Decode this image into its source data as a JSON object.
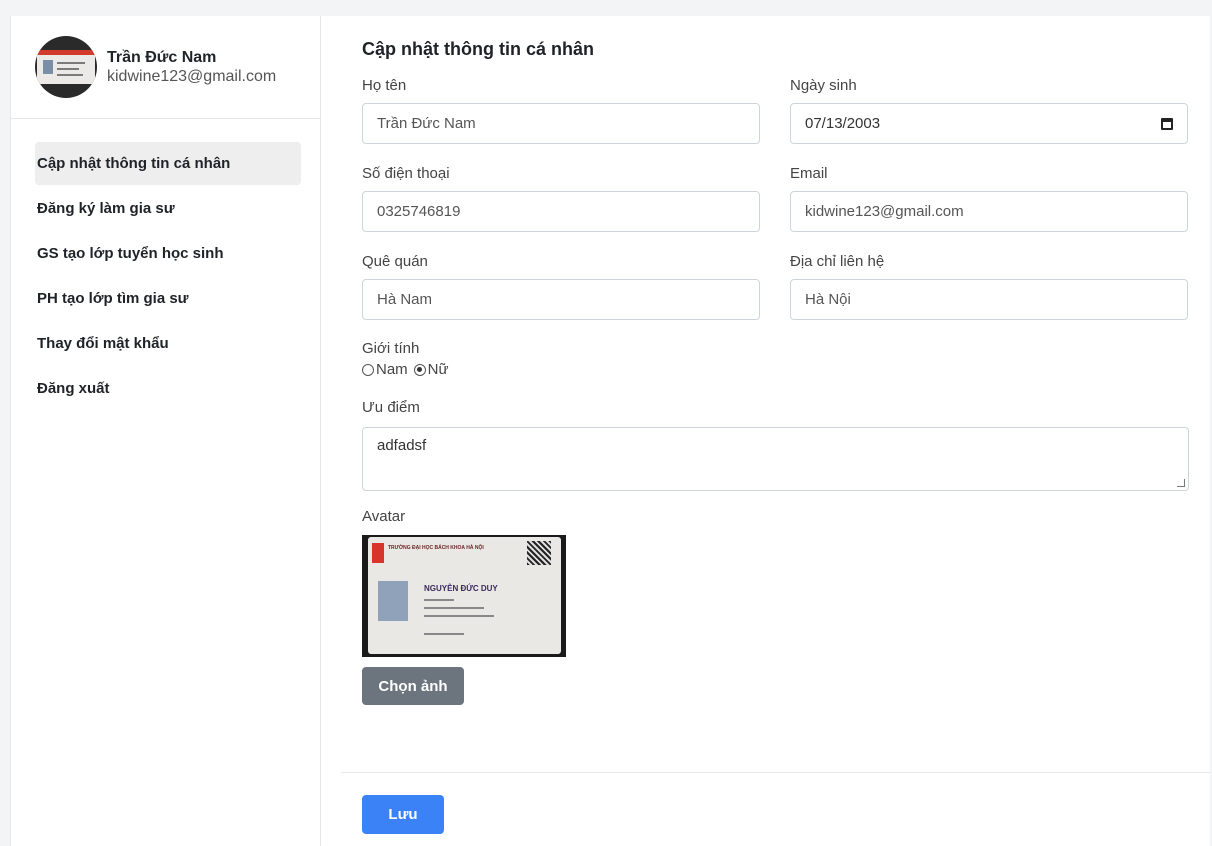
{
  "user": {
    "name": "Trần Đức Nam",
    "email": "kidwine123@gmail.com"
  },
  "menu": [
    {
      "label": "Cập nhật thông tin cá nhân",
      "active": true
    },
    {
      "label": "Đăng ký làm gia sư",
      "active": false
    },
    {
      "label": "GS tạo lớp tuyển học sinh",
      "active": false
    },
    {
      "label": "PH tạo lớp tìm gia sư",
      "active": false
    },
    {
      "label": "Thay đổi mật khẩu",
      "active": false
    },
    {
      "label": "Đăng xuất",
      "active": false
    }
  ],
  "form": {
    "title": "Cập nhật thông tin cá nhân",
    "full_name": {
      "label": "Họ tên",
      "value": "Trần Đức Nam"
    },
    "birthday": {
      "label": "Ngày sinh",
      "value": "07/13/2003"
    },
    "phone": {
      "label": "Số điện thoại",
      "value": "0325746819"
    },
    "email": {
      "label": "Email",
      "value": "kidwine123@gmail.com"
    },
    "hometown": {
      "label": "Quê quán",
      "value": "Hà Nam"
    },
    "address": {
      "label": "Địa chỉ liên hệ",
      "value": "Hà Nội"
    },
    "gender": {
      "label": "Giới tính",
      "options": [
        "Nam",
        "Nữ"
      ],
      "selected": "Nữ"
    },
    "strengths": {
      "label": "Ưu điểm",
      "value": "adfadsf"
    },
    "avatar": {
      "label": "Avatar",
      "card_school": "TRƯỜNG ĐẠI HỌC BÁCH KHOA HÀ NỘI",
      "card_name": "NGUYỄN ĐỨC DUY"
    },
    "choose_image_label": "Chọn ảnh",
    "save_label": "Lưu"
  },
  "colors": {
    "primary": "#3b82f6",
    "secondary": "#6c757d",
    "active_menu_bg": "#eeeeee"
  }
}
